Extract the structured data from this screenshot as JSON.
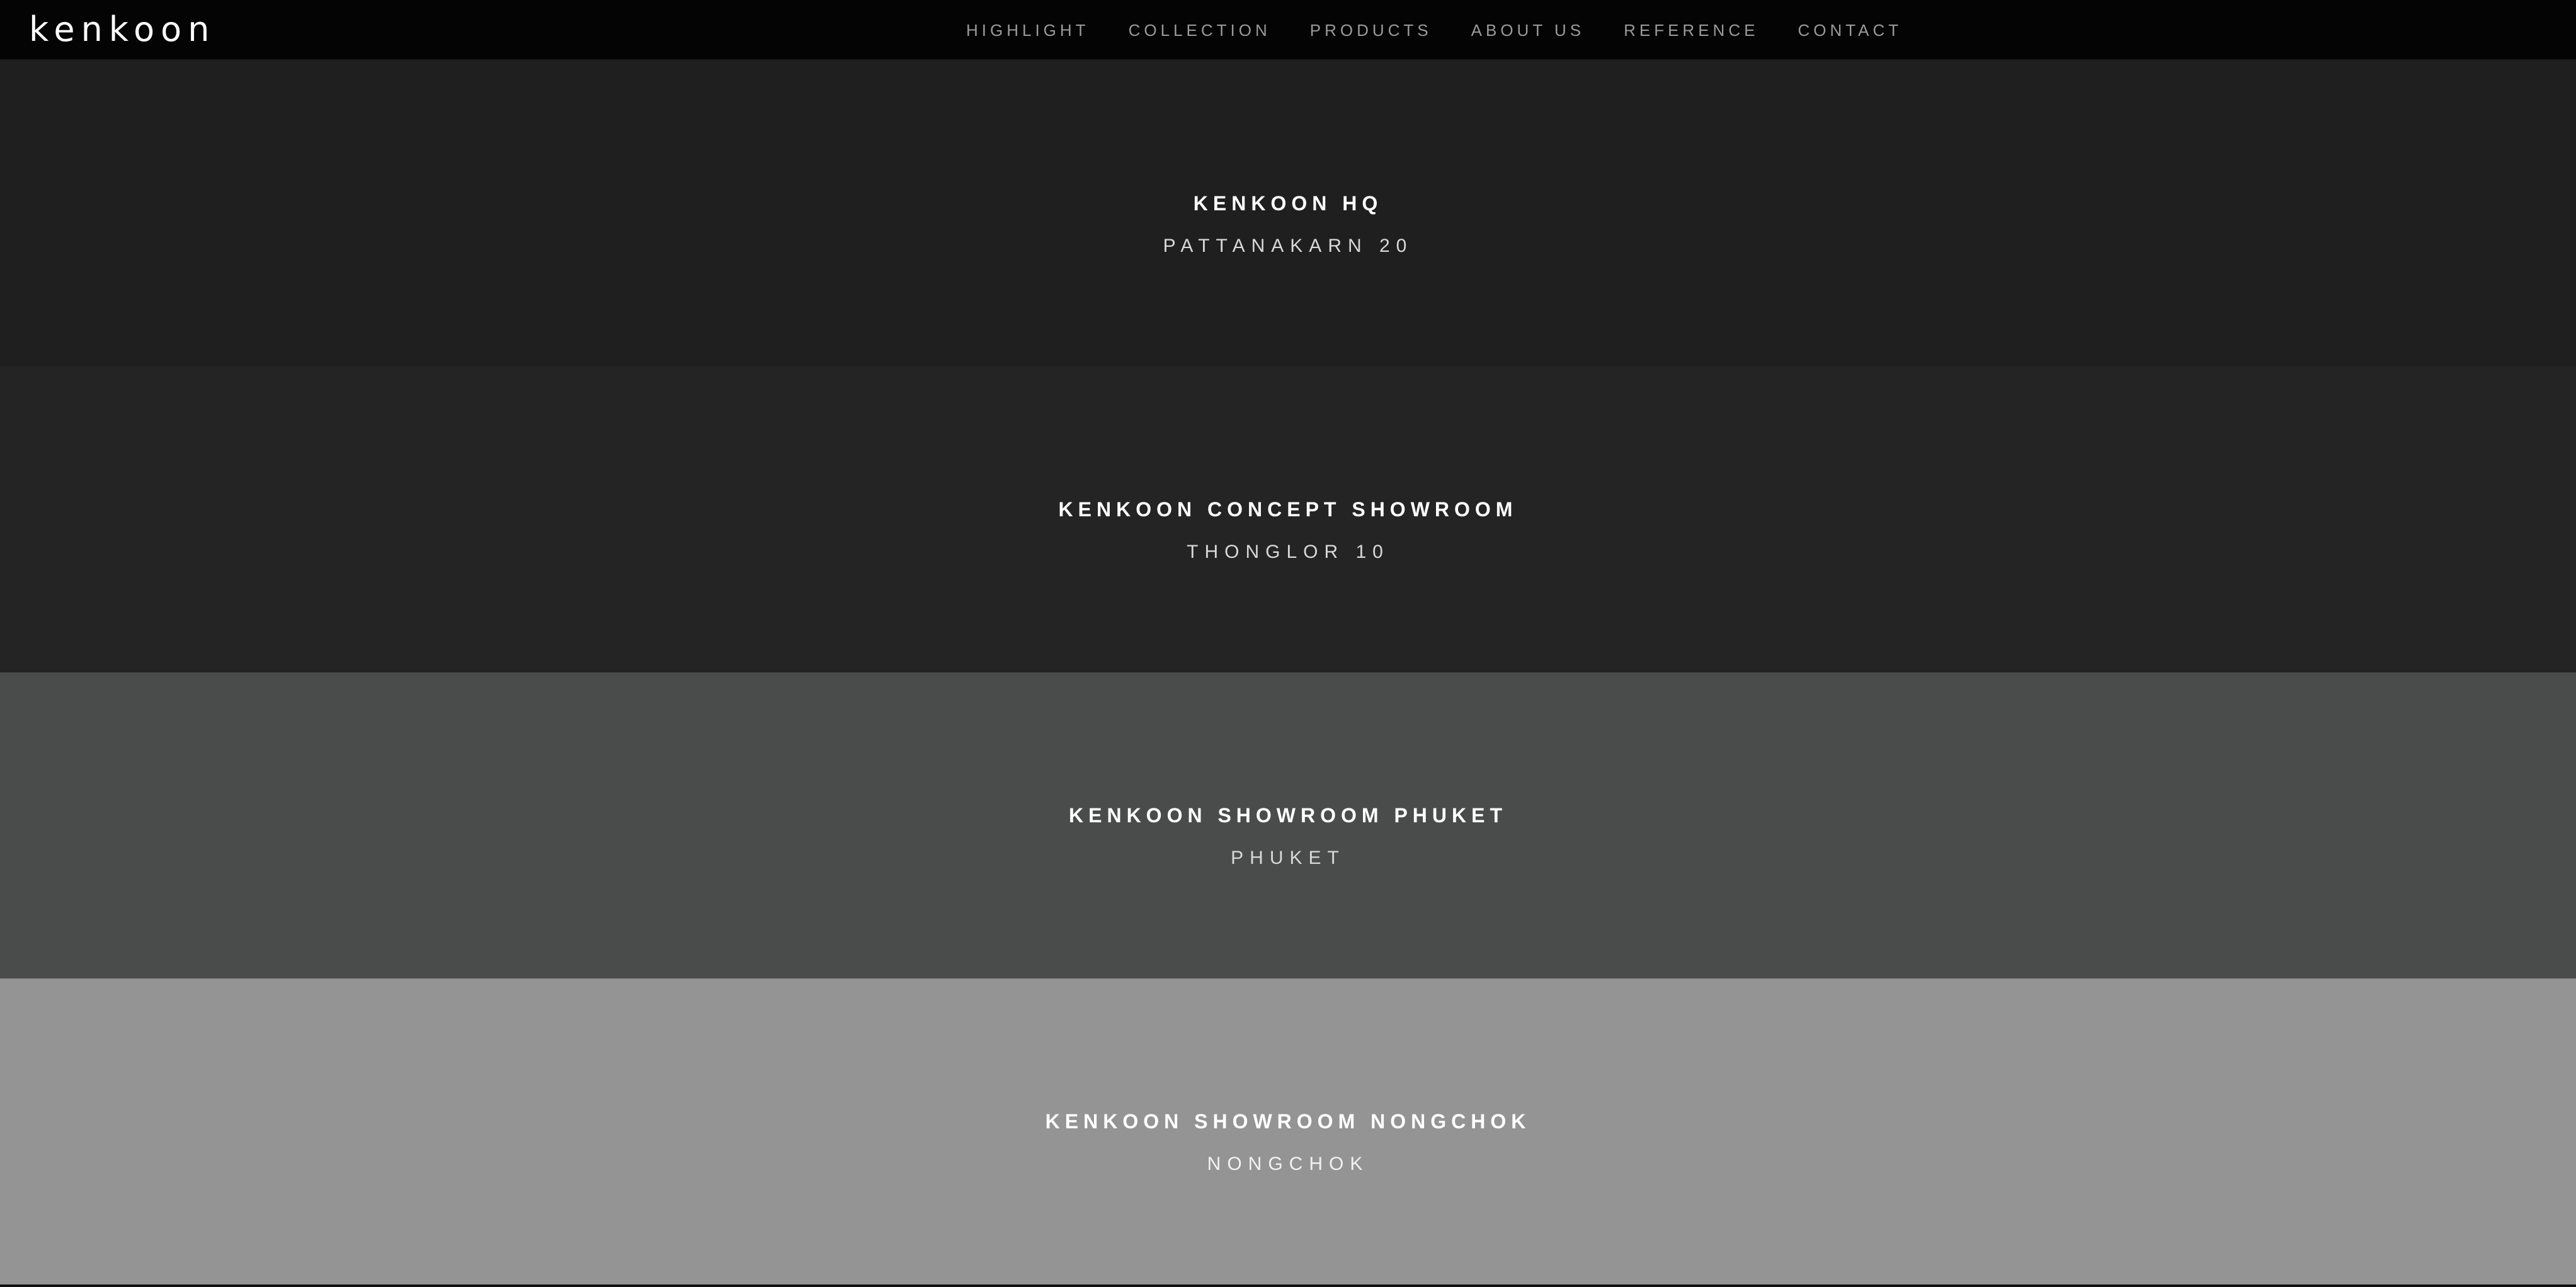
{
  "header": {
    "logo": "kenkoon",
    "nav": [
      {
        "label": "HIGHLIGHT"
      },
      {
        "label": "COLLECTION"
      },
      {
        "label": "PRODUCTS"
      },
      {
        "label": "ABOUT US"
      },
      {
        "label": "REFERENCE"
      },
      {
        "label": "CONTACT"
      }
    ]
  },
  "locations": [
    {
      "title": "KENKOON HQ",
      "subtitle": "PATTANAKARN 20",
      "background": "#1f1f1f"
    },
    {
      "title": "KENKOON CONCEPT SHOWROOM",
      "subtitle": "THONGLOR 10",
      "background": "#242424"
    },
    {
      "title": "KENKOON SHOWROOM PHUKET",
      "subtitle": "PHUKET",
      "background": "#4a4b4b"
    },
    {
      "title": "KENKOON SHOWROOM NONGCHOK",
      "subtitle": "NONGCHOK",
      "background": "#949494"
    }
  ],
  "colors": {
    "header_bg": "#040404",
    "nav_text": "#9a9a9a",
    "title_text": "#ffffff"
  }
}
